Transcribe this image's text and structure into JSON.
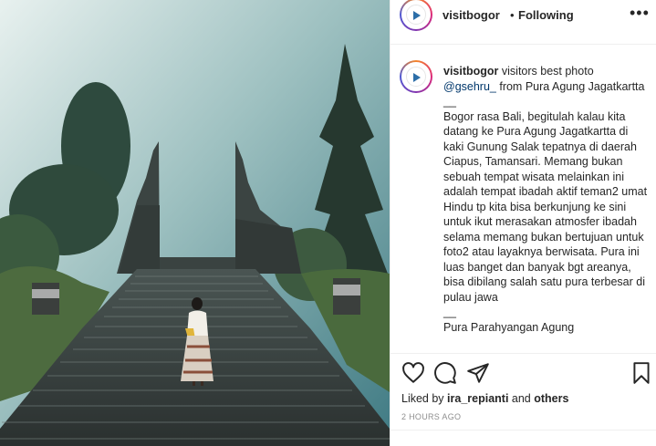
{
  "post": {
    "author": "visitbogor",
    "separator": "•",
    "follow_status": "Following",
    "more_icon": "more-horizontal-icon",
    "caption": {
      "user": "visitbogor",
      "intro": " visitors best photo ",
      "mention": "@gsehru_",
      "location_text": " from Pura Agung Jagatkartta",
      "body": "\n__\nBogor rasa Bali, begitulah kalau kita datang ke Pura Agung Jagatkartta di kaki Gunung Salak tepatnya di daerah Ciapus, Tamansari. Memang bukan sebuah tempat wisata melainkan ini adalah tempat ibadah aktif teman2 umat Hindu tp kita bisa berkunjung ke sini untuk ikut merasakan atmosfer ibadah selama memang bukan bertujuan untuk foto2 atau layaknya berwisata. Pura ini luas banget dan banyak bgt areanya, bisa dibilang salah satu pura terbesar di pulau jawa\n__\nPura Parahyangan Agung"
    },
    "actions": {
      "like_icon": "heart-icon",
      "comment_icon": "comment-icon",
      "share_icon": "paper-plane-icon",
      "save_icon": "bookmark-icon"
    },
    "likes": {
      "prefix": "Liked by ",
      "user": "ira_repianti",
      "middle": " and ",
      "others": "others"
    },
    "timestamp": "2 HOURS AGO"
  },
  "colors": {
    "text": "#262626",
    "secondary": "#8e8e8e",
    "link": "#00376b",
    "divider": "#efefef"
  }
}
